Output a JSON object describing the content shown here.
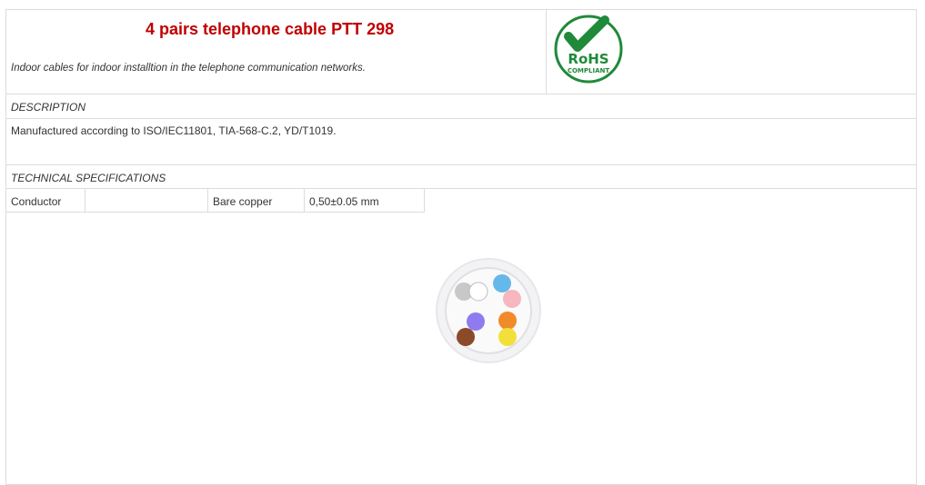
{
  "header": {
    "title": "4 pairs telephone cable PTT 298",
    "subtitle": "Indoor cables for indoor installtion in the telephone communication networks."
  },
  "logo": {
    "text_main": "RoHS",
    "text_sub": "COMPLIANT",
    "color": "#1f8a3a"
  },
  "description": {
    "heading": "DESCRIPTION",
    "text": "Manufactured according to ISO/IEC11801, TIA-568-C.2, YD/T1019."
  },
  "specs": {
    "heading": "TECHNICAL SPECIFICATIONS",
    "rows": [
      {
        "label": "Conductor",
        "sub": "",
        "value": "Bare copper",
        "extra": "0,50±0.05 mm"
      }
    ]
  },
  "colors": {
    "title": "#c00000",
    "border": "#dcdcdc"
  }
}
